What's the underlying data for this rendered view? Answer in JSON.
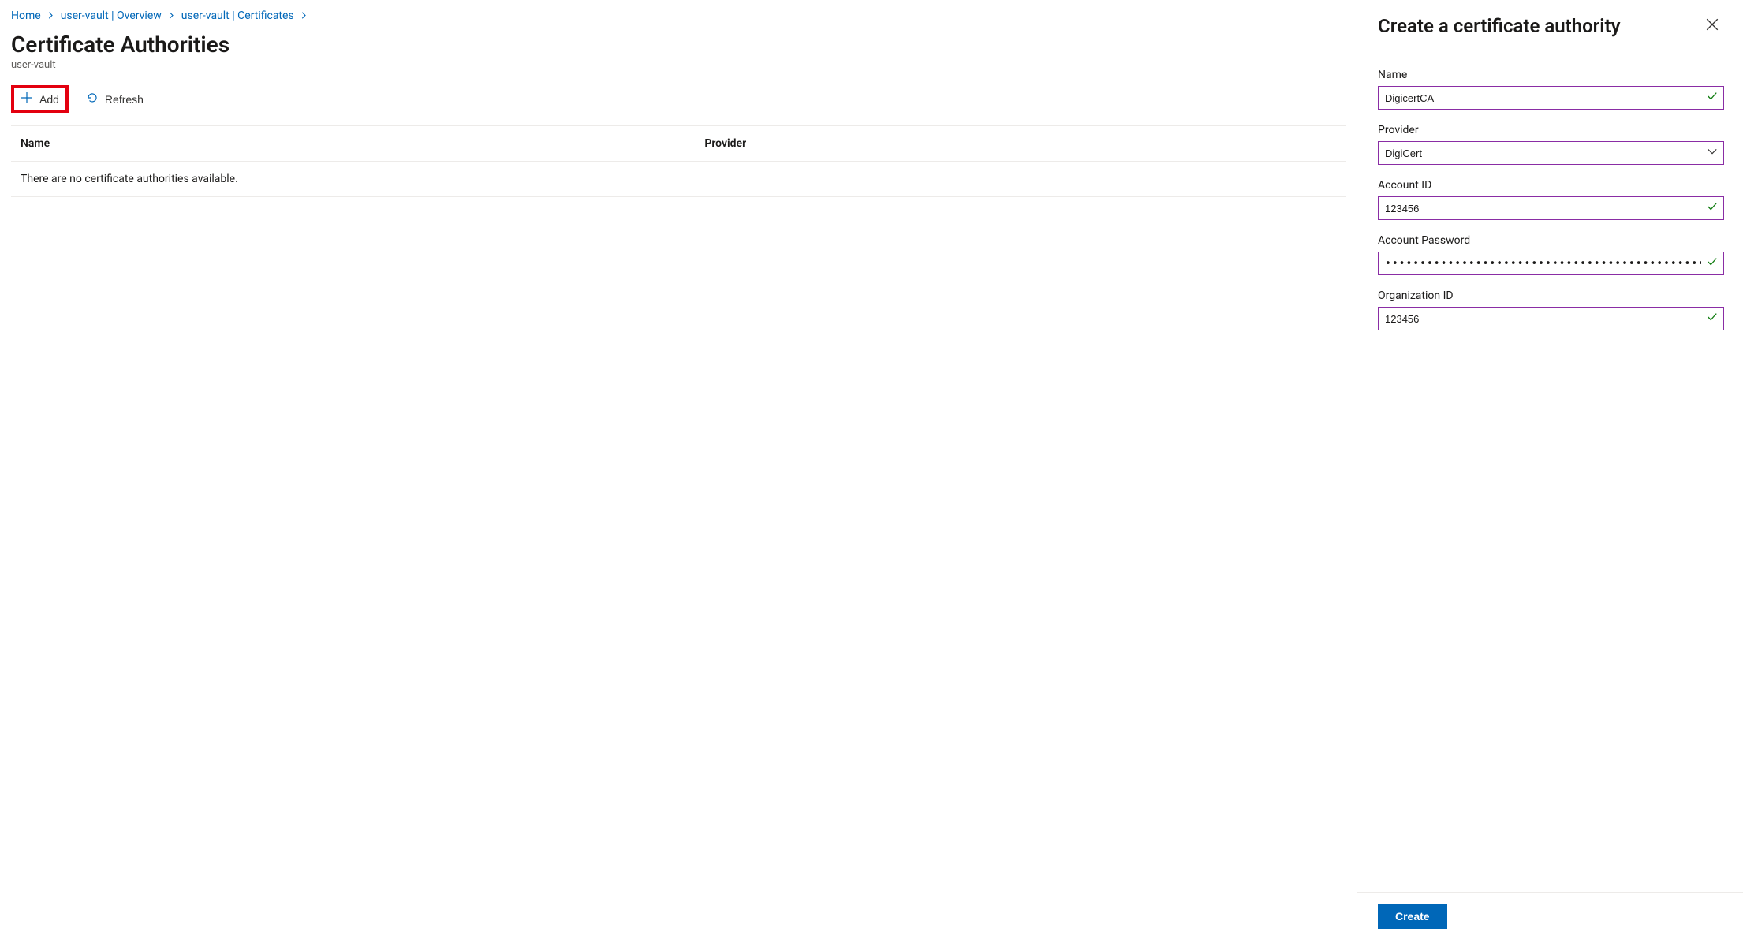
{
  "breadcrumb": {
    "items": [
      "Home",
      "user-vault | Overview",
      "user-vault | Certificates"
    ]
  },
  "header": {
    "title": "Certificate Authorities",
    "subtitle": "user-vault"
  },
  "toolbar": {
    "add_label": "Add",
    "refresh_label": "Refresh"
  },
  "table": {
    "columns": {
      "name": "Name",
      "provider": "Provider"
    },
    "empty_message": "There are no certificate authorities available."
  },
  "panel": {
    "title": "Create a certificate authority",
    "fields": {
      "name": {
        "label": "Name",
        "value": "DigicertCA"
      },
      "provider": {
        "label": "Provider",
        "value": "DigiCert"
      },
      "account_id": {
        "label": "Account ID",
        "value": "123456"
      },
      "account_password": {
        "label": "Account Password",
        "value": "••••••••••••••••••••••••••••••••••••••••••••••••••••••••••••••••••••••••••••••••••••••••••••••••"
      },
      "organization_id": {
        "label": "Organization ID",
        "value": "123456"
      }
    },
    "create_label": "Create"
  }
}
